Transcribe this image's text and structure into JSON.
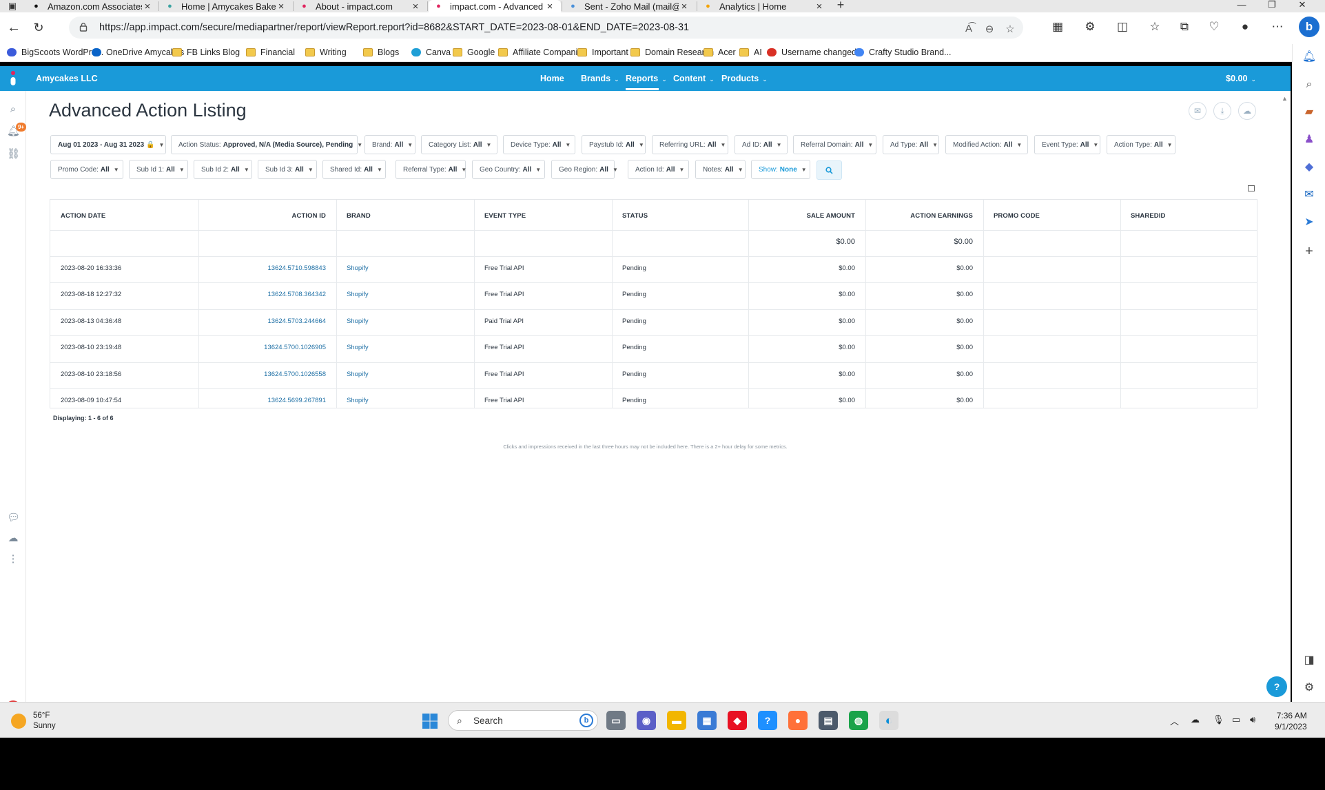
{
  "browser": {
    "tabs": [
      {
        "label": "Amazon.com Associates Central",
        "icon": "amazon-icon",
        "color": "#111111"
      },
      {
        "label": "Home | Amycakes Bakes | Media",
        "icon": "mediavine-icon",
        "color": "#3aa3a1"
      },
      {
        "label": "About - impact.com",
        "icon": "impact-icon",
        "color": "#e0245e"
      },
      {
        "label": "impact.com - Advanced Action L",
        "icon": "impact-icon",
        "color": "#e0245e"
      },
      {
        "label": "Sent - Zoho Mail (mail@honestly",
        "icon": "zoho-icon",
        "color": "#4a90d9"
      },
      {
        "label": "Analytics | Home",
        "icon": "analytics-icon",
        "color": "#f4a300"
      }
    ],
    "url": "https://app.impact.com/secure/mediapartner/report/viewReport.report?id=8682&START_DATE=2023-08-01&END_DATE=2023-08-31",
    "bookmarks": [
      {
        "label": "BigScoots WordPre...",
        "icon": "bigscoots-icon"
      },
      {
        "label": "OneDrive Amycakes",
        "icon": "onedrive-icon"
      },
      {
        "label": "FB Links Blog",
        "icon": "folder-icon"
      },
      {
        "label": "Financial",
        "icon": "folder-icon"
      },
      {
        "label": "Writing",
        "icon": "folder-icon"
      },
      {
        "label": "Blogs",
        "icon": "folder-icon"
      },
      {
        "label": "Canva",
        "icon": "canva-icon"
      },
      {
        "label": "Google",
        "icon": "folder-icon"
      },
      {
        "label": "Affiliate Companies",
        "icon": "folder-icon"
      },
      {
        "label": "Important",
        "icon": "folder-icon"
      },
      {
        "label": "Domain Research",
        "icon": "folder-icon"
      },
      {
        "label": "Acer",
        "icon": "folder-icon"
      },
      {
        "label": "AI",
        "icon": "folder-icon"
      },
      {
        "label": "Username changed...",
        "icon": "gmail-icon"
      },
      {
        "label": "Crafty Studio Brand...",
        "icon": "google-icon"
      }
    ]
  },
  "app": {
    "account": "Amycakes LLC",
    "nav": [
      {
        "label": "Home",
        "dropdown": false
      },
      {
        "label": "Brands",
        "dropdown": true
      },
      {
        "label": "Reports",
        "dropdown": true
      },
      {
        "label": "Content",
        "dropdown": true
      },
      {
        "label": "Products",
        "dropdown": true
      }
    ],
    "balance": "$0.00",
    "notification_count": "9+",
    "avatar_letter": "A",
    "page_title": "Advanced Action Listing",
    "filters_row1": [
      {
        "label": "",
        "value": "Aug 01 2023 - Aug 31 2023 🔒"
      },
      {
        "label": "Action Status:",
        "value": "Approved, N/A (Media Source), Pending"
      },
      {
        "label": "Brand:",
        "value": "All"
      },
      {
        "label": "Category List:",
        "value": "All"
      },
      {
        "label": "Device Type:",
        "value": "All"
      },
      {
        "label": "Paystub Id:",
        "value": "All"
      },
      {
        "label": "Referring URL:",
        "value": "All"
      },
      {
        "label": "Ad ID:",
        "value": "All"
      },
      {
        "label": "Referral Domain:",
        "value": "All"
      },
      {
        "label": "Ad Type:",
        "value": "All"
      },
      {
        "label": "Modified Action:",
        "value": "All"
      },
      {
        "label": "Event Type:",
        "value": "All"
      },
      {
        "label": "Action Type:",
        "value": "All"
      }
    ],
    "filters_row2": [
      {
        "label": "Promo Code:",
        "value": "All"
      },
      {
        "label": "Sub Id 1:",
        "value": "All"
      },
      {
        "label": "Sub Id 2:",
        "value": "All"
      },
      {
        "label": "Sub Id 3:",
        "value": "All"
      },
      {
        "label": "Shared Id:",
        "value": "All"
      },
      {
        "label": "Referral Type:",
        "value": "All"
      },
      {
        "label": "Geo Country:",
        "value": "All"
      },
      {
        "label": "Geo Region:",
        "value": "All"
      },
      {
        "label": "Action Id:",
        "value": "All"
      },
      {
        "label": "Notes:",
        "value": "All"
      },
      {
        "label": "Show:",
        "value": "None"
      }
    ],
    "table": {
      "columns": [
        "ACTION DATE",
        "ACTION ID",
        "BRAND",
        "EVENT TYPE",
        "STATUS",
        "SALE AMOUNT",
        "ACTION EARNINGS",
        "PROMO CODE",
        "SHAREDID"
      ],
      "totals": {
        "sale_amount": "$0.00",
        "action_earnings": "$0.00"
      },
      "rows": [
        [
          "2023-08-20 16:33:36",
          "13624.5710.598843",
          "Shopify",
          "Free Trial API",
          "Pending",
          "$0.00",
          "$0.00",
          "",
          ""
        ],
        [
          "2023-08-18 12:27:32",
          "13624.5708.364342",
          "Shopify",
          "Free Trial API",
          "Pending",
          "$0.00",
          "$0.00",
          "",
          ""
        ],
        [
          "2023-08-13 04:36:48",
          "13624.5703.244664",
          "Shopify",
          "Paid Trial API",
          "Pending",
          "$0.00",
          "$0.00",
          "",
          ""
        ],
        [
          "2023-08-10 23:19:48",
          "13624.5700.1026905",
          "Shopify",
          "Free Trial API",
          "Pending",
          "$0.00",
          "$0.00",
          "",
          ""
        ],
        [
          "2023-08-10 23:18:56",
          "13624.5700.1026558",
          "Shopify",
          "Free Trial API",
          "Pending",
          "$0.00",
          "$0.00",
          "",
          ""
        ],
        [
          "2023-08-09 10:47:54",
          "13624.5699.267891",
          "Shopify",
          "Free Trial API",
          "Pending",
          "$0.00",
          "$0.00",
          "",
          ""
        ]
      ]
    },
    "displaying": "Displaying: 1 - 6 of 6",
    "footnote": "Clicks and impressions received in the last three hours may not be included here. There is a 2+ hour delay for some metrics.",
    "help_label": "?",
    "colors": {
      "brand_blue": "#1a9ad9",
      "link": "#1d6fa5",
      "badge": "#f07c2e"
    }
  },
  "taskbar": {
    "temperature": "56°F",
    "condition": "Sunny",
    "search_placeholder": "Search",
    "time": "7:36 AM",
    "date": "9/1/2023"
  }
}
